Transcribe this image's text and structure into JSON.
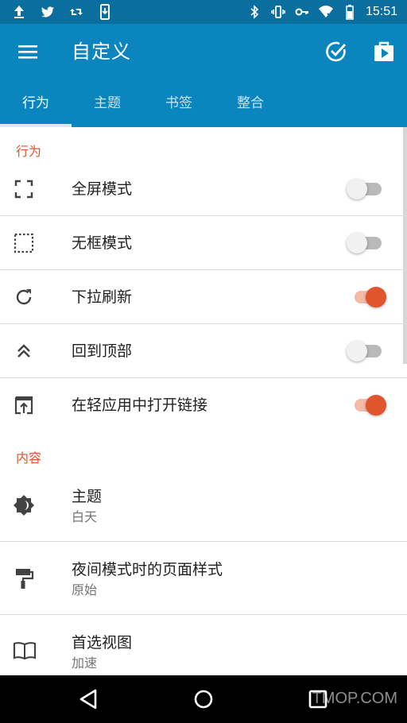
{
  "status_bar": {
    "time": "15:51"
  },
  "app_bar": {
    "title": "自定义"
  },
  "tabs": [
    {
      "label": "行为"
    },
    {
      "label": "主题"
    },
    {
      "label": "书签"
    },
    {
      "label": "整合"
    }
  ],
  "sections": {
    "behavior": {
      "header": "行为",
      "items": [
        {
          "label": "全屏模式",
          "icon": "fullscreen-icon",
          "enabled": false
        },
        {
          "label": "无框模式",
          "icon": "frameless-icon",
          "enabled": false
        },
        {
          "label": "下拉刷新",
          "icon": "refresh-icon",
          "enabled": true
        },
        {
          "label": "回到顶部",
          "icon": "double-chevron-up-icon",
          "enabled": false
        },
        {
          "label": "在轻应用中打开链接",
          "icon": "open-in-app-icon",
          "enabled": true
        }
      ]
    },
    "content": {
      "header": "内容",
      "items": [
        {
          "label": "主题",
          "value": "白天",
          "icon": "brightness-icon"
        },
        {
          "label": "夜间模式时的页面样式",
          "value": "原始",
          "icon": "paint-roller-icon"
        },
        {
          "label": "首选视图",
          "value": "加速",
          "icon": "book-icon"
        }
      ]
    }
  },
  "watermark": "ITMOP.COM",
  "colors": {
    "app_bar": "#0B85BE",
    "status_bar": "#0A6E9E",
    "accent": "#E0552B"
  }
}
